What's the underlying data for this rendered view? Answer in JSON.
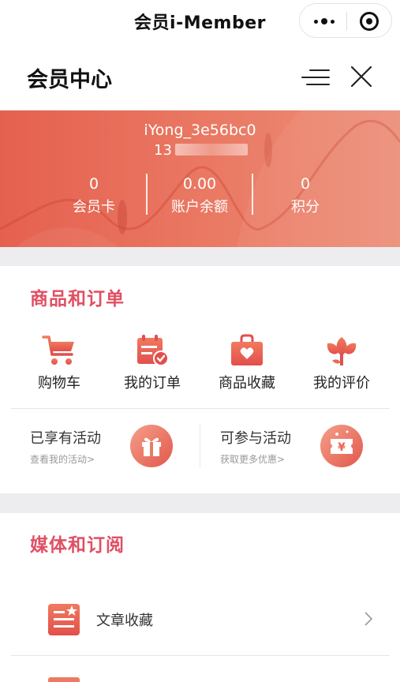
{
  "miniprogram": {
    "title": "会员i-Member"
  },
  "header": {
    "title": "会员中心"
  },
  "banner": {
    "username": "iYong_3e56bc0",
    "phone_prefix": "13",
    "stats": [
      {
        "value": "0",
        "label": "会员卡"
      },
      {
        "value": "0.00",
        "label": "账户余额"
      },
      {
        "value": "0",
        "label": "积分"
      }
    ]
  },
  "orders": {
    "title": "商品和订单",
    "items": [
      {
        "label": "购物车",
        "icon": "shopping-cart-icon"
      },
      {
        "label": "我的订单",
        "icon": "order-calendar-icon"
      },
      {
        "label": "商品收藏",
        "icon": "favorite-bag-icon"
      },
      {
        "label": "我的评价",
        "icon": "rating-flower-icon"
      }
    ],
    "activities": [
      {
        "title": "已享有活动",
        "subtitle": "查看我的活动>",
        "icon": "gift-icon"
      },
      {
        "title": "可参与活动",
        "subtitle": "获取更多优惠>",
        "icon": "coupon-yen-icon"
      }
    ]
  },
  "media": {
    "title": "媒体和订阅",
    "rows": [
      {
        "label": "文章收藏",
        "icon": "article-star-icon"
      }
    ]
  },
  "colors": {
    "accent": "#e04f63",
    "banner": "#e8705c"
  }
}
